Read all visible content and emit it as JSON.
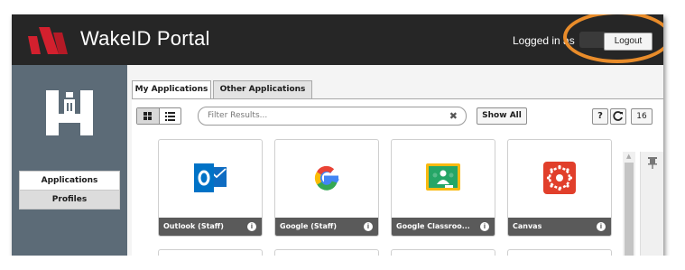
{
  "header": {
    "app_title": "WakeID Portal",
    "logged_in_text": "Logged in as",
    "logout_label": "Logout"
  },
  "sidebar": {
    "items": [
      {
        "label": "Applications"
      },
      {
        "label": "Profiles"
      }
    ]
  },
  "tabs": [
    {
      "label": "My Applications",
      "active": true
    },
    {
      "label": "Other Applications",
      "active": false
    }
  ],
  "toolbar": {
    "filter_placeholder": "Filter Results...",
    "show_all_label": "Show All",
    "help_label": "?",
    "count_label": "16"
  },
  "apps": [
    {
      "label": "Outlook (Staff)",
      "icon": "outlook-icon"
    },
    {
      "label": "Google (Staff)",
      "icon": "google-icon"
    },
    {
      "label": "Google Classroo...",
      "icon": "google-classroom-icon"
    },
    {
      "label": "Canvas",
      "icon": "canvas-icon"
    }
  ],
  "colors": {
    "header_bg": "#262626",
    "sidebar_bg": "#5c6b77",
    "tile_footer": "#5a5a5a",
    "highlight_ring": "#e98c2a",
    "logo_red": "#d3202e"
  }
}
